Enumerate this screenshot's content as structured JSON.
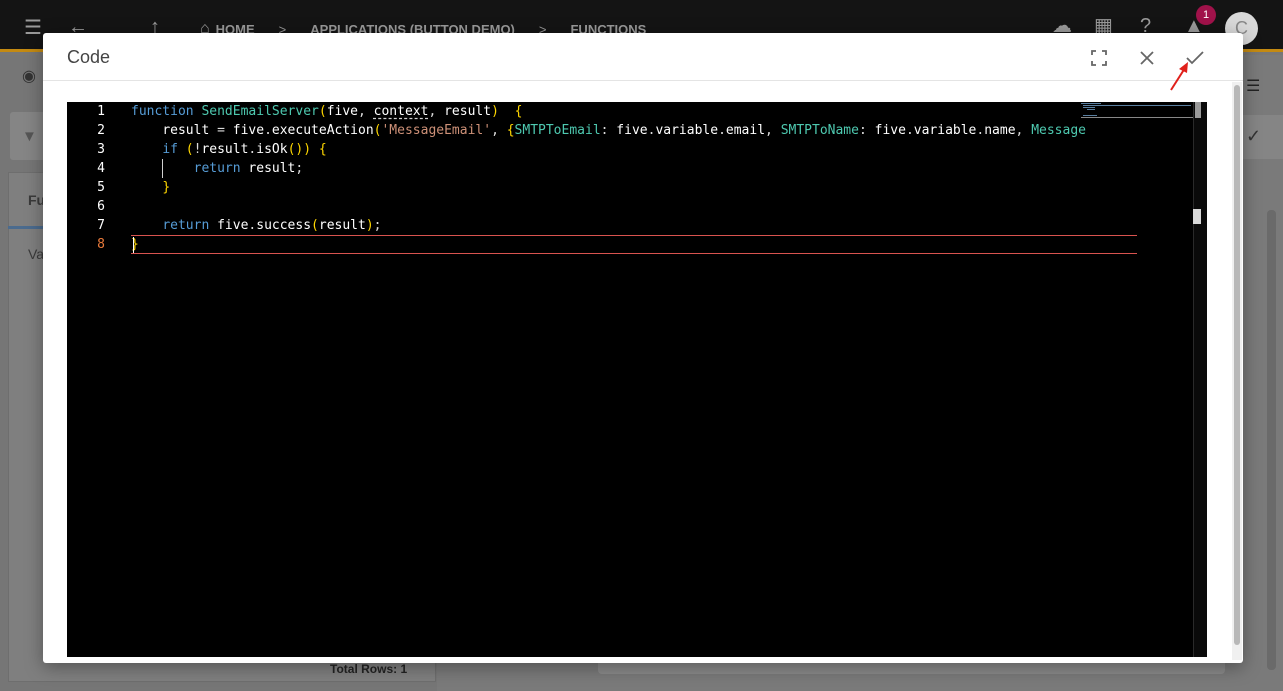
{
  "app": {
    "breadcrumbs": [
      "HOME",
      "APPLICATIONS (BUTTON DEMO)",
      "FUNCTIONS"
    ],
    "notification_count": "1",
    "avatar_initial": "C",
    "background_tab_label": "Fu",
    "background_row_label": "Va",
    "total_rows": "Total Rows: 1"
  },
  "dialog": {
    "title": "Code",
    "buttons": {
      "fullscreen": "fullscreen-icon",
      "close": "close-icon",
      "confirm": "check-icon"
    }
  },
  "editor": {
    "line_numbers": [
      "1",
      "2",
      "3",
      "4",
      "5",
      "6",
      "7",
      "8"
    ],
    "active_line": "8",
    "lines": [
      "function SendEmailServer(five, context, result)  {",
      "    result = five.executeAction('MessageEmail', {SMTPToEmail: five.variable.email, SMTPToName: five.variable.name, Message",
      "    if (!result.isOk()) {",
      "        return result;",
      "    }",
      "",
      "    return five.success(result);",
      "}"
    ]
  },
  "colors": {
    "accent_bar": "#c48a12",
    "annotation_arrow": "#e0201b",
    "editor_bg": "#000000",
    "active_line_border": "#d9534f",
    "badge": "#a0124a"
  }
}
